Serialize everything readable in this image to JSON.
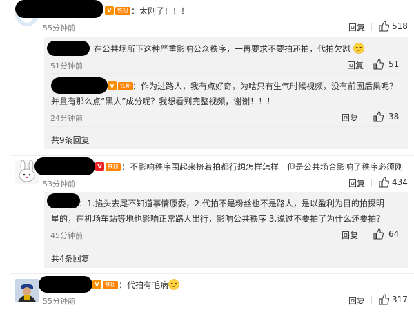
{
  "comments": [
    {
      "text": "：太刚了！！！",
      "time": "55分钟前",
      "reply": "回复",
      "likes": "518",
      "replies": [
        {
          "text": "在公共场所下这种严重影响公众秩序，一再要求不要拍还拍，代拍欠怼",
          "time": "51分钟前",
          "reply": "回复",
          "likes": "51"
        },
        {
          "line1": "：作为过路人，我有点好奇，为啥只有生气时候视频，没有前因后果呢？",
          "line2": "并且有那么点“黑人”成分呢？我想看到完整视频，谢谢！！！",
          "time": "24分钟前",
          "reply": "回复",
          "likes": "38"
        }
      ],
      "more": "共9条回复"
    },
    {
      "text": "：不影响秩序围起来挤着拍都行想怎样怎样　但是公共场合影响了秩序必须刚",
      "time": "53分钟前",
      "reply": "回复",
      "likes": "434",
      "replies": [
        {
          "line1": "：1.掐头去尾不知道事情原委，2.代拍不是粉丝也不是路人，是以盈利为目的拍摄明",
          "line2": "星的，在机场车站等地也影响正常路人出行，影响公共秩序 3.说过不要拍了为什么还要拍？",
          "time": "45分钟前",
          "reply": "回复",
          "likes": "64"
        }
      ],
      "more": "共4条回复"
    },
    {
      "text": "：代拍有毛病",
      "time": "55分钟前",
      "reply": "回复",
      "likes": "317"
    }
  ],
  "badge": {
    "vip": "V",
    "fan": "铁粉"
  },
  "icons": {
    "like": "thumb-up-icon",
    "emoji": "smirk-emoji-icon"
  },
  "colors": {
    "redaction": "#000000",
    "subbox": "#f2f2f2",
    "fan_badge": "#ff8200"
  }
}
